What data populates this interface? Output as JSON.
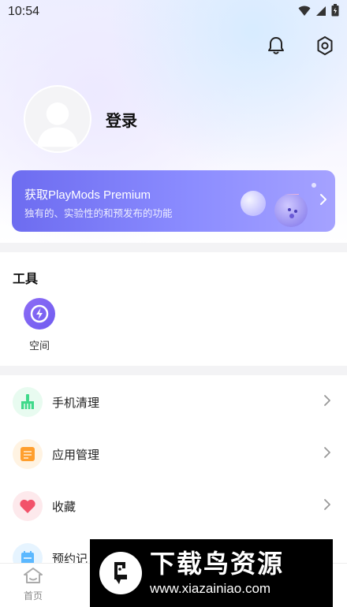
{
  "status_bar": {
    "time": "10:54"
  },
  "icons": {
    "bell": "bell-icon",
    "settings": "gear-icon",
    "wifi": "wifi-icon",
    "signal": "signal-icon",
    "battery": "battery-icon"
  },
  "profile": {
    "login_label": "登录"
  },
  "premium_banner": {
    "title": "获取PlayMods Premium",
    "subtitle": "独有的、实验性的和预发布的功能"
  },
  "tools": {
    "section_title": "工具",
    "items": [
      {
        "label": "空间",
        "icon": "space-bolt-icon"
      }
    ]
  },
  "menu": {
    "items": [
      {
        "label": "手机清理",
        "icon": "broom-icon",
        "color": "#e8fbf0"
      },
      {
        "label": "应用管理",
        "icon": "app-manage-icon",
        "color": "#fff3e2"
      },
      {
        "label": "收藏",
        "icon": "heart-icon",
        "color": "#fde9ec"
      },
      {
        "label": "预约记",
        "icon": "calendar-icon",
        "color": "#e6f4ff"
      }
    ]
  },
  "bottom_nav": {
    "home_label": "首页"
  },
  "watermark": {
    "title": "下载鸟资源",
    "url": "www.xiazainiao.com"
  },
  "colors": {
    "accent": "#7b6cf6",
    "premium_gradient_start": "#6d6cf0",
    "premium_gradient_end": "#a5a2ff"
  }
}
